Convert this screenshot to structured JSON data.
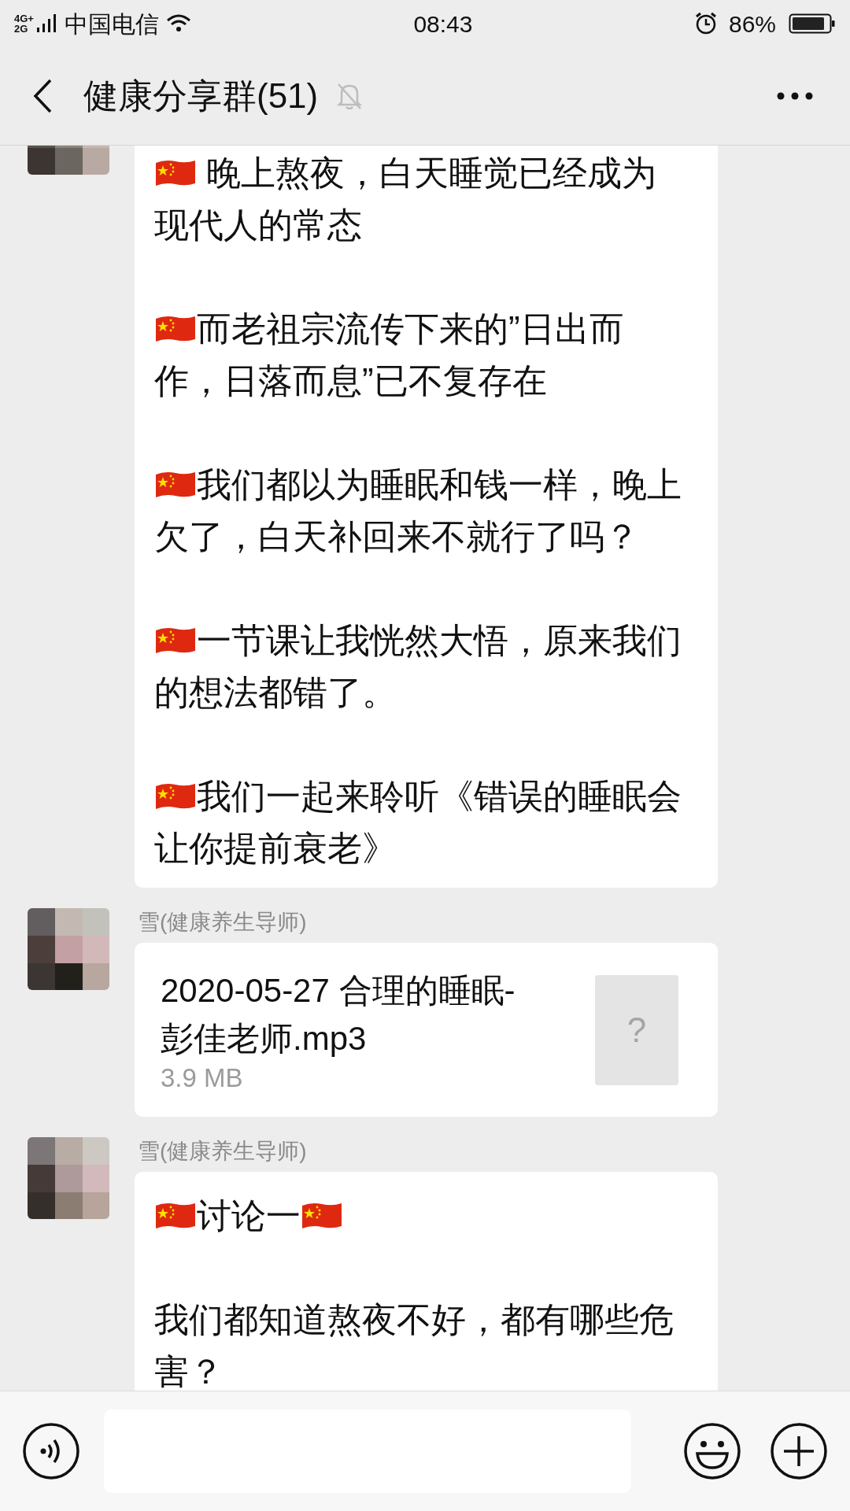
{
  "status_bar": {
    "network_top": "4G+",
    "network_bottom": "2G",
    "carrier": "中国电信",
    "time": "08:43",
    "battery": "86%"
  },
  "header": {
    "title": "健康分享群(51)",
    "muted": true
  },
  "messages": [
    {
      "kind": "text",
      "paragraphs": [
        {
          "text": " 晚上熬夜，白天睡觉已经成为现代人的常态",
          "flag_before": true,
          "flag_after": false
        },
        {
          "text": "而老祖宗流传下来的”日出而作，日落而息”已不复存在",
          "flag_before": true,
          "flag_after": false
        },
        {
          "text": "我们都以为睡眠和钱一样，晚上欠了，白天补回来不就行了吗？",
          "flag_before": true,
          "flag_after": false
        },
        {
          "text": "一节课让我恍然大悟，原来我们的想法都错了。",
          "flag_before": true,
          "flag_after": false
        },
        {
          "text": "我们一起来聆听《错误的睡眠会让你提前衰老》",
          "flag_before": true,
          "flag_after": false
        }
      ]
    },
    {
      "kind": "file",
      "sender": "雪(健康养生导师)",
      "file_name": "2020-05-27 合理的睡眠-彭佳老师.mp3",
      "file_size": "3.9 MB",
      "file_icon": "?"
    },
    {
      "kind": "text",
      "sender": "雪(健康养生导师)",
      "paragraphs": [
        {
          "text": "讨论一",
          "flag_before": true,
          "flag_after": true
        },
        {
          "text": "我们都知道熬夜不好，都有哪些危害？",
          "flag_before": false,
          "flag_after": false
        }
      ]
    }
  ]
}
